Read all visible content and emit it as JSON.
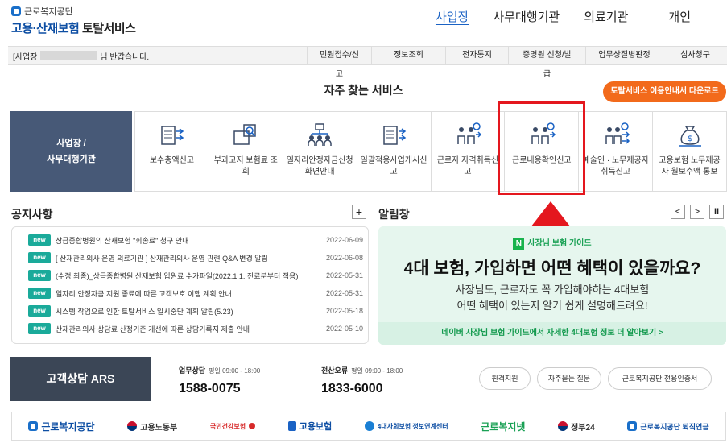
{
  "logo": {
    "top": "근로복지공단",
    "main_a": "고용·산재보험",
    "main_b": "토탈서비스"
  },
  "topnav": [
    "사업장",
    "사무대행기관",
    "의료기관",
    "개인"
  ],
  "bar": {
    "welcome_prefix": "[사업장",
    "welcome_suffix": "님 반갑습니다.",
    "menu": [
      "민원접수/신고",
      "정보조회",
      "전자통지",
      "증명원 신청/발급",
      "업무상질병판정",
      "심사청구"
    ]
  },
  "services": {
    "title": "자주 찾는 서비스",
    "download": "토탈서비스 이용안내서 다운로드",
    "side_line1": "사업장 /",
    "side_line2": "사무대행기관",
    "items": [
      {
        "label": "보수총액신고",
        "icon": "document-arrow-icon"
      },
      {
        "label": "부과고지 보험료 조회",
        "icon": "search-document-icon"
      },
      {
        "label": "일자리안정자금신청화면안내",
        "icon": "people-network-icon"
      },
      {
        "label": "일괄적용사업개시신고",
        "icon": "document-arrow-icon"
      },
      {
        "label": "근로자 자격취득신고",
        "icon": "workers-icon"
      },
      {
        "label": "근로내용확인신고",
        "icon": "workers-icon"
      },
      {
        "label": "예술인 · 노무제공자 취득신고",
        "icon": "workers-arrow-icon"
      },
      {
        "label": "고용보험 노무제공자 월보수액 통보",
        "icon": "money-bag-icon"
      }
    ]
  },
  "notice": {
    "title": "공지사항",
    "plus": "+",
    "badge": "new",
    "items": [
      {
        "text": "상급종합병원의 산재보험 \"회송료\" 청구 안내",
        "date": "2022-06-09"
      },
      {
        "text": "[ 산재관리의사 운영 의료기관 ] 산재관리의사 운영 관련 Q&A 변경 알림",
        "date": "2022-06-08"
      },
      {
        "text": "(수정 최종)_상급종합병원 산재보험 입원료 수가파일(2022.1.1. 진료분부터 적용)",
        "date": "2022-05-31"
      },
      {
        "text": "일자리 안정자금 지원 종료에 따른 고객보호 이행 계획 안내",
        "date": "2022-05-31"
      },
      {
        "text": "시스템 작업으로 인한 토탈서비스 일시중단 계획 알림(5.23)",
        "date": "2022-05-18"
      },
      {
        "text": "산재관리의사 상담료 산정기준 개선에 따른 상담기록지 제출 안내",
        "date": "2022-05-10"
      }
    ]
  },
  "alert": {
    "title": "알림창",
    "prev": "<",
    "next": ">",
    "pause": "II",
    "tag": "사장님 보험 가이드",
    "head": "4대 보험, 가입하면 어떤 혜택이 있을까요?",
    "sub1": "사장님도, 근로자도 꼭 가입해야하는 4대보험",
    "sub2": "어떤 혜택이 있는지 알기 쉽게 설명해드려요!",
    "foot": "네이버 사장님 보험 가이드에서 자세한 4대보험 정보 더 알아보기 >"
  },
  "support": {
    "ars": "고객상담 ARS",
    "biz_label": "업무상담",
    "biz_hours": "평일 09:00 - 18:00",
    "biz_num": "1588-0075",
    "err_label": "전산오류",
    "err_hours": "평일 09:00 - 18:00",
    "err_num": "1833-6000",
    "buttons": [
      "원격지원",
      "자주묻는 질문",
      "근로복지공단 전용인증서"
    ]
  },
  "partners": [
    "근로복지공단",
    "고용노동부",
    "국민건강보험",
    "고용보험",
    "4대사회보험 정보연계센터",
    "근로복지넷",
    "정부24",
    "근로복지공단 퇴직연금"
  ],
  "colors": {
    "accent": "#1a62c4",
    "orange": "#f26a1b",
    "teal": "#1aaa9a",
    "green": "#19b34d",
    "red": "#e4171e"
  }
}
